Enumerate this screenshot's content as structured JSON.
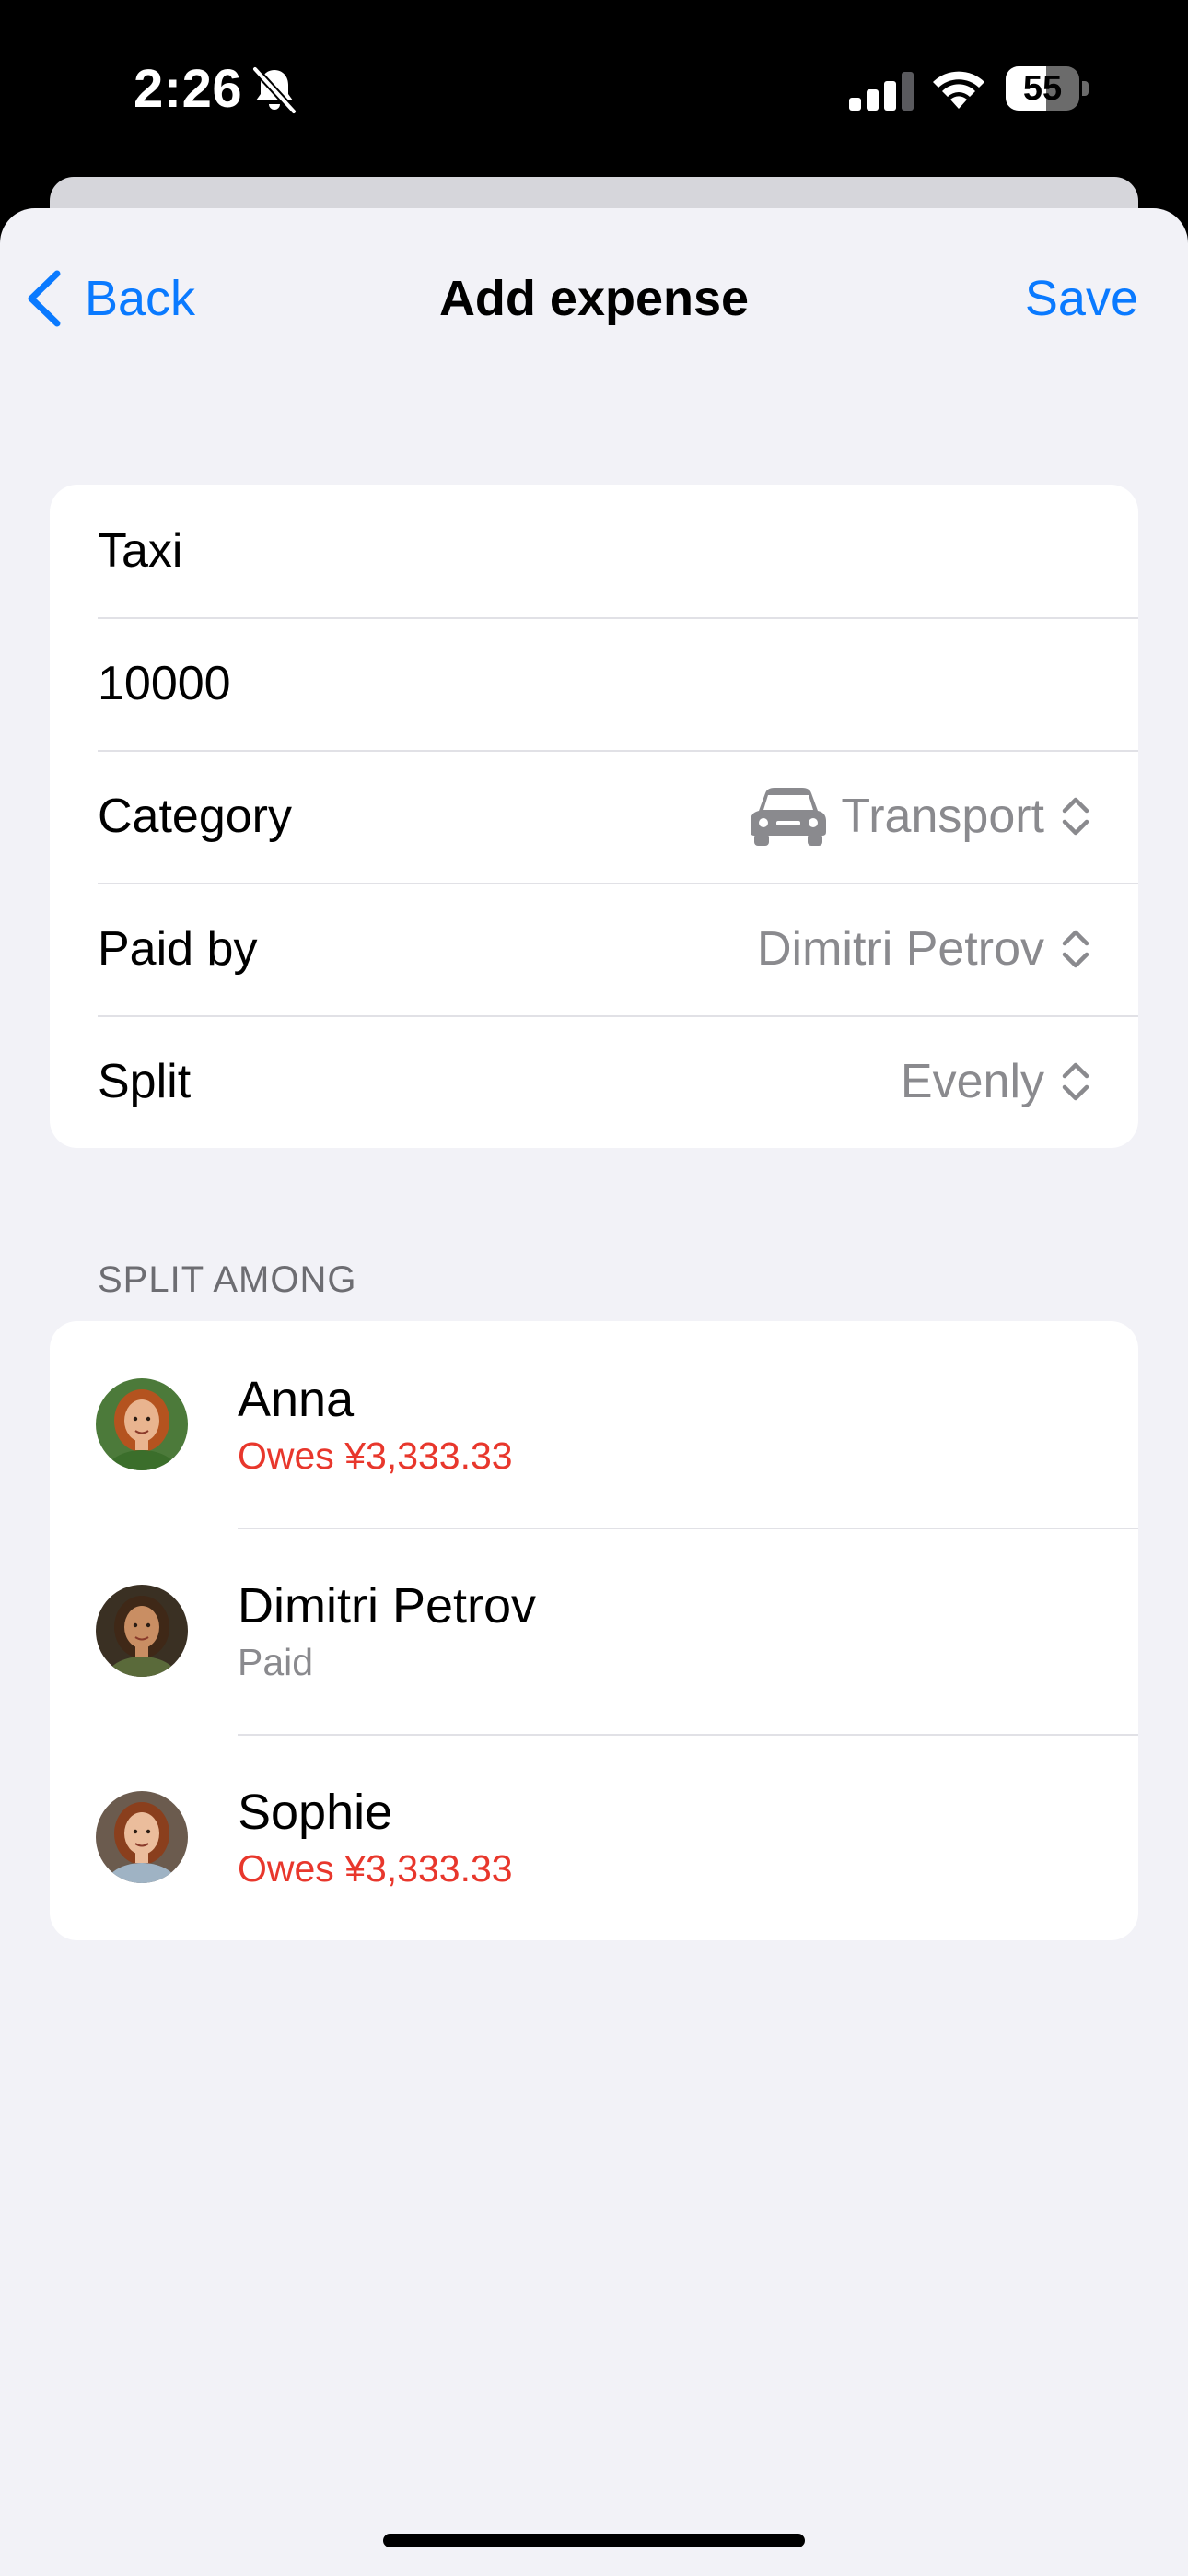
{
  "status_bar": {
    "time": "2:26",
    "battery_percent": "55",
    "battery_level": 0.55,
    "signal_bars": 3,
    "signal_max": 4,
    "icons": [
      "bell-slash-icon",
      "cellular-signal-icon",
      "wifi-icon",
      "battery-icon"
    ]
  },
  "nav": {
    "back_label": "Back",
    "title": "Add expense",
    "save_label": "Save"
  },
  "form": {
    "title_value": "Taxi",
    "amount_value": "10000",
    "category": {
      "label": "Category",
      "value": "Transport",
      "icon": "car-icon"
    },
    "paid_by": {
      "label": "Paid by",
      "value": "Dimitri Petrov"
    },
    "split": {
      "label": "Split",
      "value": "Evenly"
    }
  },
  "split_section": {
    "header": "SPLIT AMONG",
    "members": [
      {
        "name": "Anna",
        "status": "Owes ¥3,333.33",
        "status_color": "#e8372c",
        "avatar_bg": "#4c7a3a",
        "hair": "#b4531f",
        "skin": "#e9b48f",
        "shirt": "#3b6e2b"
      },
      {
        "name": "Dimitri Petrov",
        "status": "Paid",
        "status_color": "#8a8a8e",
        "avatar_bg": "#3a3023",
        "hair": "#3f2817",
        "skin": "#c98e63",
        "shirt": "#5a6a3a"
      },
      {
        "name": "Sophie",
        "status": "Owes ¥3,333.33",
        "status_color": "#e8372c",
        "avatar_bg": "#6b5b4e",
        "hair": "#8a3f1d",
        "skin": "#ebbd9c",
        "shirt": "#9fb3c4"
      }
    ]
  },
  "colors": {
    "accent": "#0a7aff",
    "owes": "#e8372c",
    "secondary_text": "#8a8a8e",
    "background": "#f2f2f7"
  }
}
